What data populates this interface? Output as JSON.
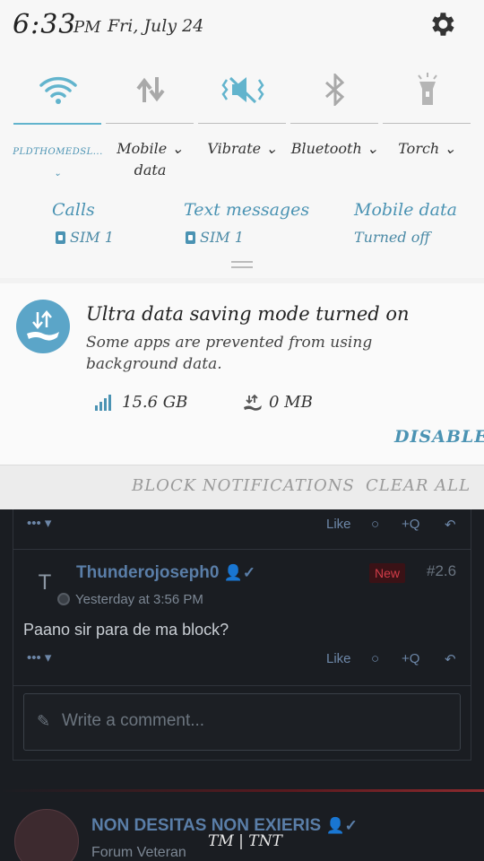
{
  "status_bar": {
    "time": "6:33",
    "ampm": "PM",
    "date": "Fri, July 24"
  },
  "quick_settings": {
    "tiles": [
      {
        "label": "PLDTHOMEDSL...",
        "icon": "wifi-icon",
        "active": true
      },
      {
        "label": "Mobile",
        "label2": "data",
        "icon": "mobile-data-icon",
        "active": false
      },
      {
        "label": "Vibrate",
        "icon": "vibrate-icon",
        "active": true
      },
      {
        "label": "Bluetooth",
        "icon": "bluetooth-icon",
        "active": false
      },
      {
        "label": "Torch",
        "icon": "torch-icon",
        "active": false
      }
    ],
    "sim_info": [
      {
        "title": "Calls",
        "value": "SIM 1"
      },
      {
        "title": "Text messages",
        "value": "SIM 1"
      },
      {
        "title": "Mobile data",
        "value": "Turned off"
      }
    ]
  },
  "notification": {
    "title": "Ultra data saving mode turned on",
    "body": "Some apps are prevented from using background data.",
    "stats": [
      {
        "icon": "signal-bars-icon",
        "value": "15.6 GB"
      },
      {
        "icon": "data-saving-icon",
        "value": "0 MB"
      }
    ],
    "action": "DISABLE"
  },
  "footer": {
    "block": "BLOCK NOTIFICATIONS",
    "clear": "CLEAR ALL"
  },
  "forum": {
    "actions": {
      "dots": "•••",
      "like": "Like",
      "quote": "+Q"
    },
    "post": {
      "avatar_letter": "T",
      "username": "Thunderojoseph0",
      "badge": "New",
      "number": "#2.6",
      "time": "Yesterday at 3:56 PM",
      "text": "Paano sir para de ma block?"
    },
    "comment_placeholder": "Write a comment...",
    "next_post": {
      "username": "NON DESITAS NON EXIERIS",
      "rank": "Forum Veteran"
    },
    "watermark": "TM | TNT"
  },
  "colors": {
    "accent": "#4b93b3",
    "active_line": "#62b4cd",
    "forum_bg": "#1a1d22",
    "forum_link": "#5a7ea8",
    "new_badge": "#d23c48"
  }
}
